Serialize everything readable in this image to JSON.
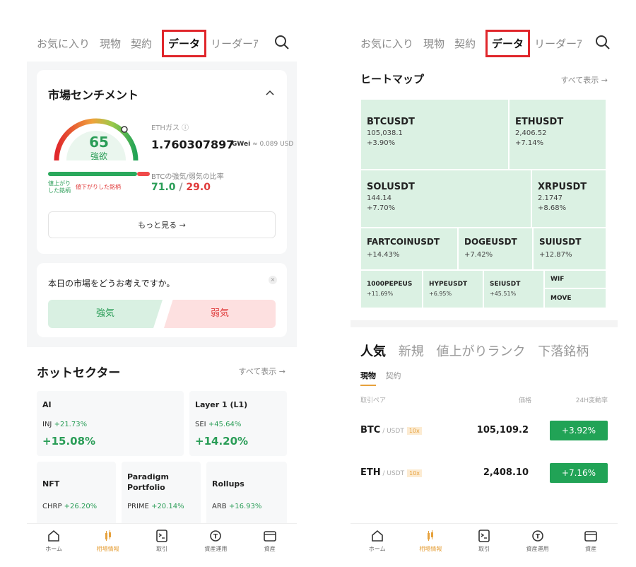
{
  "left": {
    "tabs": [
      "お気に入り",
      "現物",
      "契約",
      "データ",
      "リーダーｱ"
    ],
    "active_tab": "データ",
    "sentiment": {
      "title": "市場センチメント",
      "score": "65",
      "score_label": "強欲",
      "eth_gas_label": "ETHガス ⓘ",
      "eth_gas_value": "1.760307897",
      "eth_gas_unit": "GWei",
      "eth_gas_usd": "≈ 0.089 USD",
      "ratio_label": "BTCの強気/弱気の比率",
      "up_label": "値上がりした銘柄",
      "down_label": "値下がりした銘柄",
      "ratio_up": "71.0",
      "ratio_sep": " / ",
      "ratio_down": "29.0",
      "more": "もっと見る →"
    },
    "poll": {
      "question": "本日の市場をどうお考えですか。",
      "close": "×",
      "bull": "強気",
      "bear": "弱気"
    },
    "hot": {
      "title": "ホットセクター",
      "see_all": "すべて表示 →",
      "sectors": [
        {
          "name": "AI",
          "ticker": "INJ",
          "ticker_chg": "+21.73%",
          "chg": "+15.08%"
        },
        {
          "name": "Layer 1 (L1)",
          "ticker": "SEI",
          "ticker_chg": "+45.64%",
          "chg": "+14.20%"
        },
        {
          "name": "NFT",
          "ticker": "CHRP",
          "ticker_chg": "+26.20%",
          "chg": ""
        },
        {
          "name": "Paradigm Portfolio",
          "ticker": "PRIME",
          "ticker_chg": "+20.14%",
          "chg": ""
        },
        {
          "name": "Rollups",
          "ticker": "ARB",
          "ticker_chg": "+16.93%",
          "chg": ""
        }
      ]
    }
  },
  "right": {
    "tabs": [
      "お気に入り",
      "現物",
      "契約",
      "データ",
      "リーダーｱ"
    ],
    "active_tab": "データ",
    "heatmap": {
      "title": "ヒートマップ",
      "see_all": "すべて表示 →",
      "tiles": [
        {
          "sym": "BTCUSDT",
          "price": "105,038.1",
          "chg": "+3.90%"
        },
        {
          "sym": "ETHUSDT",
          "price": "2,406.52",
          "chg": "+7.14%"
        },
        {
          "sym": "SOLUSDT",
          "price": "144.14",
          "chg": "+7.70%"
        },
        {
          "sym": "XRPUSDT",
          "price": "2.1747",
          "chg": "+8.68%"
        },
        {
          "sym": "FARTCOINUSDT",
          "price": "",
          "chg": "+14.43%"
        },
        {
          "sym": "DOGEUSDT",
          "price": "",
          "chg": "+7.42%"
        },
        {
          "sym": "SUIUSDT",
          "price": "",
          "chg": "+12.87%"
        },
        {
          "sym": "1000PEPEUS",
          "price": "",
          "chg": "+11.69%"
        },
        {
          "sym": "HYPEUSDT",
          "price": "",
          "chg": "+6.95%"
        },
        {
          "sym": "SEIUSDT",
          "price": "",
          "chg": "+45.51%"
        },
        {
          "sym": "WIF",
          "price": "",
          "chg": ""
        },
        {
          "sym": "MOVE",
          "price": "",
          "chg": ""
        }
      ]
    },
    "rank_tabs": [
      "人気",
      "新規",
      "値上がりランク",
      "下落銘柄"
    ],
    "sub_tabs": [
      "現物",
      "契約"
    ],
    "columns": [
      "取引ペア",
      "価格",
      "24H変動率"
    ],
    "rows": [
      {
        "base": "BTC",
        "quote": " / USDT",
        "lev": "10x",
        "price": "105,109.2",
        "chg": "+3.92%"
      },
      {
        "base": "ETH",
        "quote": " / USDT",
        "lev": "10x",
        "price": "2,408.10",
        "chg": "+7.16%"
      }
    ]
  },
  "nav": [
    {
      "label": "ホーム",
      "icon": "home-icon"
    },
    {
      "label": "相場情報",
      "icon": "market-icon"
    },
    {
      "label": "取引",
      "icon": "trade-icon"
    },
    {
      "label": "資産運用",
      "icon": "earn-icon"
    },
    {
      "label": "資産",
      "icon": "wallet-icon"
    }
  ],
  "colors": {
    "green": "#2a9d57",
    "red": "#e03b3b",
    "accent": "#e6a13c",
    "highlight": "#e0262b",
    "heat": "#dbf1e3"
  }
}
